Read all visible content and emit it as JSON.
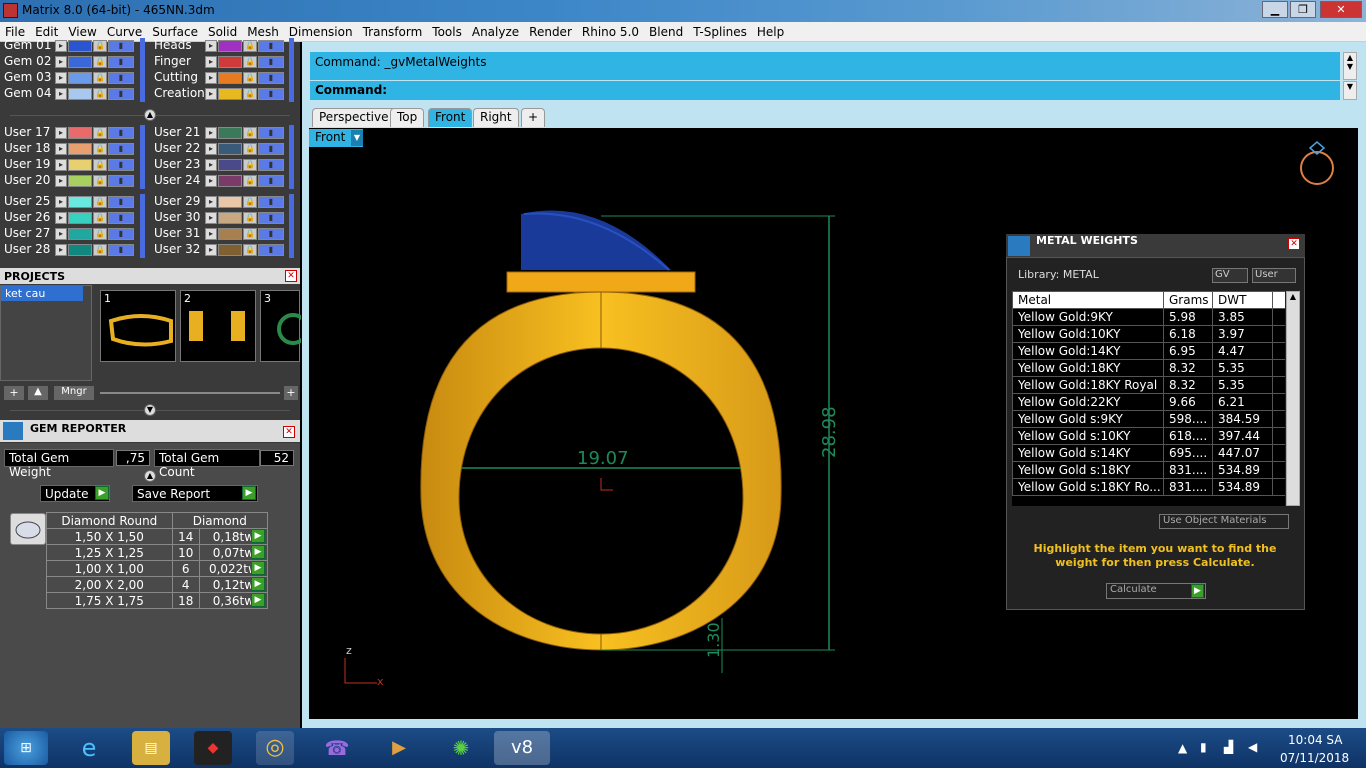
{
  "window": {
    "title": "Matrix 8.0 (64-bit) - 465NN.3dm",
    "min": "▁",
    "max": "❐",
    "close": "✕"
  },
  "menu": [
    "File",
    "Edit",
    "View",
    "Curve",
    "Surface",
    "Solid",
    "Mesh",
    "Dimension",
    "Transform",
    "Tools",
    "Analyze",
    "Render",
    "Rhino 5.0",
    "Blend",
    "T-Splines",
    "Help"
  ],
  "layers": {
    "group1_left": [
      {
        "name": "Gem 01",
        "color": "#2a55d0"
      },
      {
        "name": "Gem 02",
        "color": "#3a68d8"
      },
      {
        "name": "Gem 03",
        "color": "#6a9ae8"
      },
      {
        "name": "Gem 04",
        "color": "#a8c8f0"
      }
    ],
    "group1_right": [
      {
        "name": "Heads",
        "color": "#a030c0"
      },
      {
        "name": "Finger",
        "color": "#d03a3a"
      },
      {
        "name": "Cutting",
        "color": "#e87a20"
      },
      {
        "name": "Creation",
        "color": "#e8b820"
      }
    ],
    "group2_left": [
      {
        "name": "User 17",
        "color": "#e86a6a"
      },
      {
        "name": "User 18",
        "color": "#e8a070"
      },
      {
        "name": "User 19",
        "color": "#e8d070"
      },
      {
        "name": "User 20",
        "color": "#a8d060"
      }
    ],
    "group2_right": [
      {
        "name": "User 21",
        "color": "#3a7a5a"
      },
      {
        "name": "User 22",
        "color": "#3a5a7a"
      },
      {
        "name": "User 23",
        "color": "#4a4a8a"
      },
      {
        "name": "User 24",
        "color": "#7a3a6a"
      }
    ],
    "group3_left": [
      {
        "name": "User 25",
        "color": "#6ae8e0"
      },
      {
        "name": "User 26",
        "color": "#3ad0c0"
      },
      {
        "name": "User 27",
        "color": "#20a8a0"
      },
      {
        "name": "User 28",
        "color": "#108880"
      }
    ],
    "group3_right": [
      {
        "name": "User 29",
        "color": "#e8c8a8"
      },
      {
        "name": "User 30",
        "color": "#c8a880"
      },
      {
        "name": "User 31",
        "color": "#a88050"
      },
      {
        "name": "User 32",
        "color": "#806030"
      }
    ]
  },
  "projects": {
    "title": "PROJECTS",
    "item": "ket cau",
    "thumb_numbers": [
      "1",
      "2",
      "3"
    ],
    "mngr": "Mngr"
  },
  "gem_reporter": {
    "title": "GEM REPORTER",
    "total_weight_label": "Total Gem Weight",
    "total_weight": ",75",
    "total_count_label": "Total Gem Count",
    "total_count": "52",
    "update": "Update",
    "save_report": "Save Report",
    "col1": "Diamond Round",
    "col2": "Diamond",
    "rows": [
      {
        "size": "1,50 X 1,50",
        "count": "14",
        "weight": "0,18tw"
      },
      {
        "size": "1,25 X 1,25",
        "count": "10",
        "weight": "0,07tw"
      },
      {
        "size": "1,00 X 1,00",
        "count": "6",
        "weight": "0,022tw"
      },
      {
        "size": "2,00 X 2,00",
        "count": "4",
        "weight": "0,12tw"
      },
      {
        "size": "1,75 X 1,75",
        "count": "18",
        "weight": "0,36tw"
      }
    ]
  },
  "command": {
    "line1": "Command: _gvMetalWeights",
    "line2": "Command:"
  },
  "tabs": [
    "Perspective",
    "Top",
    "Front",
    "Right",
    "+"
  ],
  "viewport": {
    "label": "Front",
    "dim_width": "19.07",
    "dim_height": "28.98",
    "dim_thick": "1.30",
    "axis_z": "z",
    "axis_x": "x"
  },
  "metal_weights": {
    "title": "METAL WEIGHTS",
    "library": "Library: METAL",
    "gv": "GV",
    "user": "User",
    "headers": [
      "Metal",
      "Grams",
      "DWT"
    ],
    "rows": [
      [
        "Yellow Gold:9KY",
        "5.98",
        "3.85"
      ],
      [
        "Yellow Gold:10KY",
        "6.18",
        "3.97"
      ],
      [
        "Yellow Gold:14KY",
        "6.95",
        "4.47"
      ],
      [
        "Yellow Gold:18KY",
        "8.32",
        "5.35"
      ],
      [
        "Yellow Gold:18KY Royal",
        "8.32",
        "5.35"
      ],
      [
        "Yellow Gold:22KY",
        "9.66",
        "6.21"
      ],
      [
        "Yellow Gold s:9KY",
        "598....",
        "384.59"
      ],
      [
        "Yellow Gold s:10KY",
        "618....",
        "397.44"
      ],
      [
        "Yellow Gold s:14KY",
        "695....",
        "447.07"
      ],
      [
        "Yellow Gold s:18KY",
        "831....",
        "534.89"
      ],
      [
        "Yellow Gold s:18KY Ro...",
        "831....",
        "534.89"
      ]
    ],
    "use_object_materials": "Use Object Materials",
    "hint": "Highlight the item you want to find the weight for then press Calculate.",
    "calculate": "Calculate"
  },
  "taskbar": {
    "time": "10:04 SA",
    "date": "07/11/2018"
  }
}
